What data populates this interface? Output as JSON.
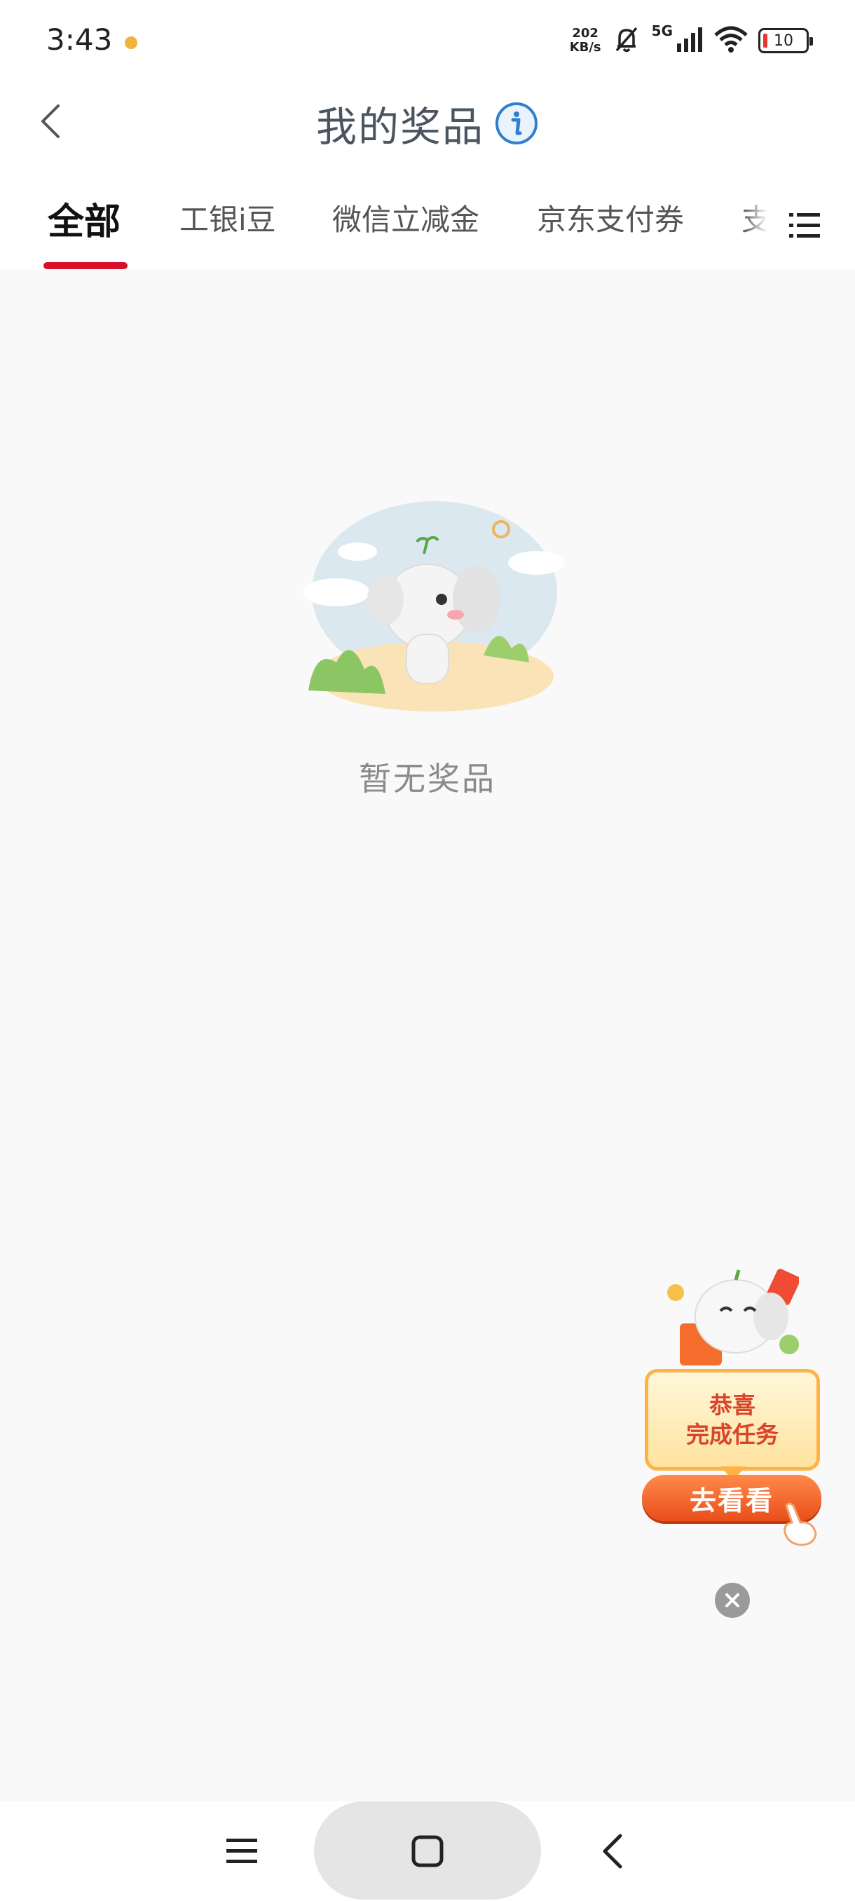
{
  "status_bar": {
    "time": "3:43",
    "net_speed_value": "202",
    "net_speed_unit": "KB/s",
    "network_type": "5G",
    "battery": "10"
  },
  "header": {
    "title": "我的奖品"
  },
  "tabs": [
    {
      "label": "全部",
      "active": true
    },
    {
      "label": "工银i豆",
      "active": false
    },
    {
      "label": "微信立减金",
      "active": false
    },
    {
      "label": "京东支付券",
      "active": false
    },
    {
      "label": "支",
      "active": false
    }
  ],
  "empty_state": {
    "text": "暂无奖品"
  },
  "promo": {
    "line1": "恭喜",
    "line2": "完成任务",
    "button_label": "去看看"
  },
  "colors": {
    "accent": "#d7102c",
    "title": "#4a5560",
    "info_icon": "#2f7fd0",
    "promo_button": "#e94e1b"
  },
  "icons": {
    "back": "chevron-left-icon",
    "info": "info-icon",
    "menu": "list-menu-icon",
    "close": "close-icon",
    "sys_menu": "hamburger-icon",
    "sys_home": "square-icon",
    "sys_back": "chevron-left-icon"
  }
}
